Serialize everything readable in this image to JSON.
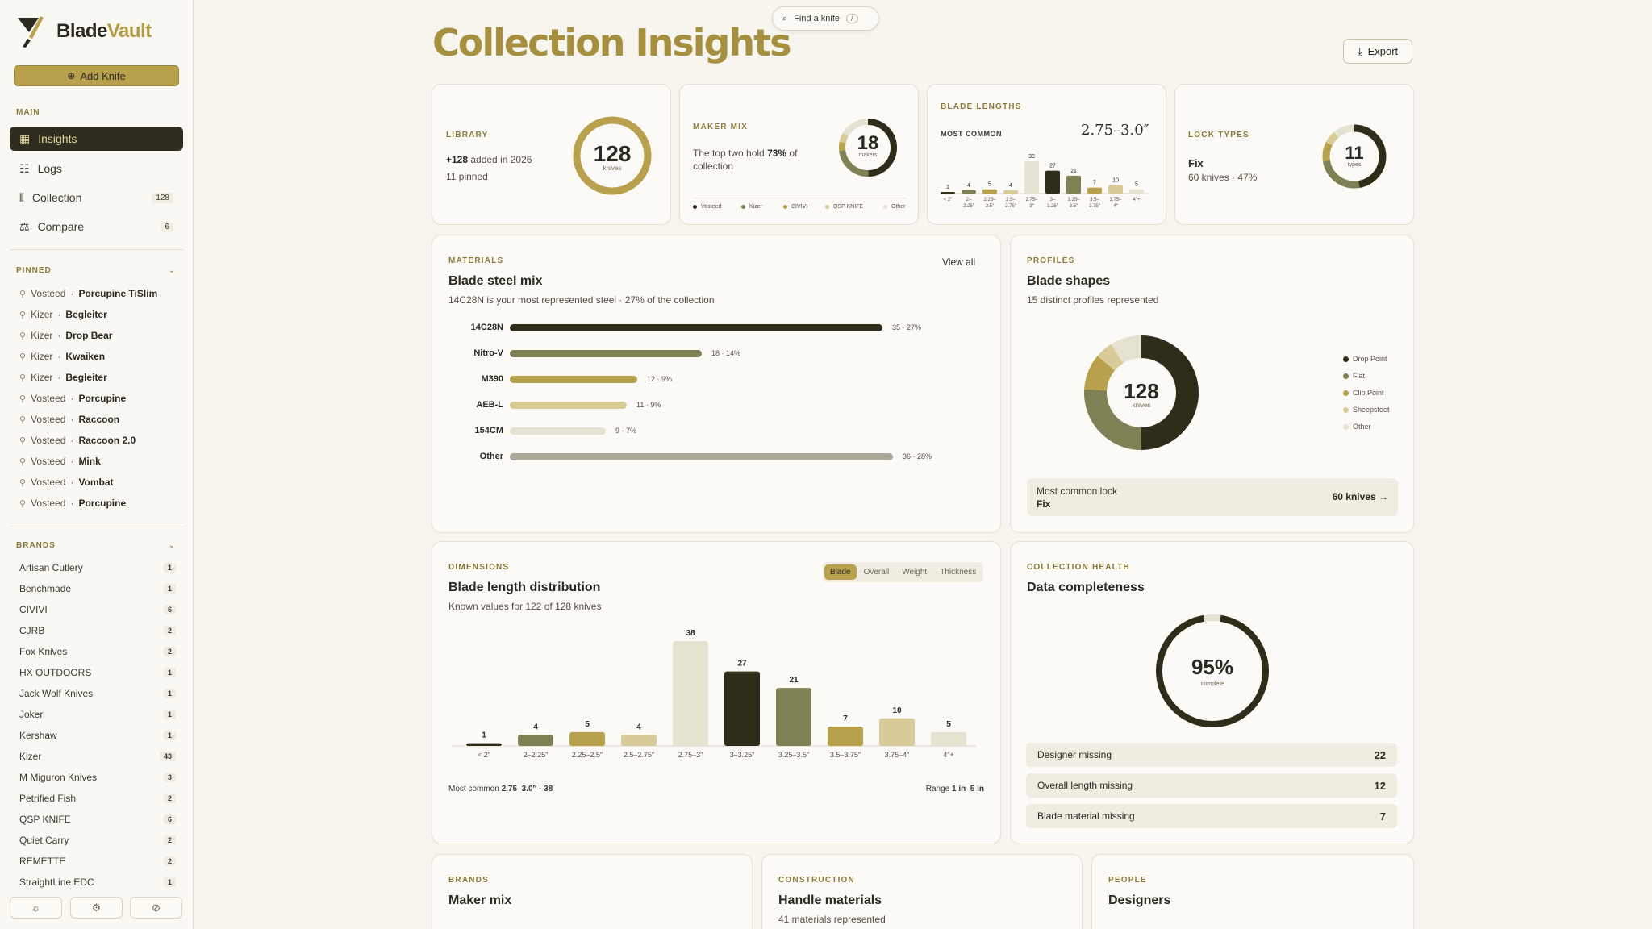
{
  "app": {
    "brand_a": "Blade",
    "brand_b": "Vault",
    "add_label": "Add Knife"
  },
  "search": {
    "label": "Find a knife",
    "shortcut": "/"
  },
  "nav": {
    "section": "MAIN",
    "items": [
      {
        "label": "Insights",
        "count": ""
      },
      {
        "label": "Logs",
        "count": ""
      },
      {
        "label": "Collection",
        "count": "128"
      },
      {
        "label": "Compare",
        "count": "6"
      }
    ]
  },
  "pinned": {
    "section": "PINNED",
    "items": [
      {
        "brand": "Vosteed",
        "model": "Porcupine TiSlim"
      },
      {
        "brand": "Kizer",
        "model": "Begleiter"
      },
      {
        "brand": "Kizer",
        "model": "Drop Bear"
      },
      {
        "brand": "Kizer",
        "model": "Kwaiken"
      },
      {
        "brand": "Kizer",
        "model": "Begleiter"
      },
      {
        "brand": "Vosteed",
        "model": "Porcupine"
      },
      {
        "brand": "Vosteed",
        "model": "Raccoon"
      },
      {
        "brand": "Vosteed",
        "model": "Raccoon 2.0"
      },
      {
        "brand": "Vosteed",
        "model": "Mink"
      },
      {
        "brand": "Vosteed",
        "model": "Vombat"
      },
      {
        "brand": "Vosteed",
        "model": "Porcupine"
      }
    ]
  },
  "brands": {
    "section": "BRANDS",
    "items": [
      {
        "name": "Artisan Cutlery",
        "count": "1"
      },
      {
        "name": "Benchmade",
        "count": "1"
      },
      {
        "name": "CIVIVI",
        "count": "6"
      },
      {
        "name": "CJRB",
        "count": "2"
      },
      {
        "name": "Fox Knives",
        "count": "2"
      },
      {
        "name": "HX OUTDOORS",
        "count": "1"
      },
      {
        "name": "Jack Wolf Knives",
        "count": "1"
      },
      {
        "name": "Joker",
        "count": "1"
      },
      {
        "name": "Kershaw",
        "count": "1"
      },
      {
        "name": "Kizer",
        "count": "43"
      },
      {
        "name": "M Miguron Knives",
        "count": "3"
      },
      {
        "name": "Petrified Fish",
        "count": "2"
      },
      {
        "name": "QSP KNIFE",
        "count": "6"
      },
      {
        "name": "Quiet Carry",
        "count": "2"
      },
      {
        "name": "REMETTE",
        "count": "2"
      },
      {
        "name": "StraightLine EDC",
        "count": "1"
      }
    ]
  },
  "page": {
    "title": "Collection Insights",
    "export": "Export"
  },
  "library": {
    "eyebrow": "LIBRARY",
    "added_num": "+128",
    "added_text": " added in 2026",
    "pinned": "11 pinned",
    "total": "128",
    "unit": "knives"
  },
  "maker_mix": {
    "eyebrow": "MAKER MIX",
    "text_a": "The top two hold ",
    "pct": "73%",
    "text_b": " of collection",
    "count": "18",
    "unit": "makers",
    "legend": [
      "Vosteed",
      "Kizer",
      "CIVIVI",
      "QSP KNIFE",
      "Other"
    ]
  },
  "blade_lengths_card": {
    "eyebrow": "BLADE LENGTHS",
    "most_common_label": "MOST COMMON",
    "most_common": "2.75–3.0″",
    "labels": [
      "< 2″",
      "2–2.25″",
      "2.25–2.5″",
      "2.5–2.75″",
      "2.75–3″",
      "3–3.25″",
      "3.25–3.5″",
      "3.5–3.75″",
      "3.75–4″",
      "4″+"
    ],
    "values": [
      1,
      4,
      5,
      4,
      38,
      27,
      21,
      7,
      10,
      5
    ]
  },
  "lock_types": {
    "eyebrow": "LOCK TYPES",
    "name": "Fix",
    "detail": "60 knives · 47%",
    "count": "11",
    "unit": "types"
  },
  "materials": {
    "eyebrow": "MATERIALS",
    "title": "Blade steel mix",
    "view_all": "View all",
    "subtitle": "14C28N is your most represented steel · 27% of the collection",
    "rows": [
      {
        "name": "14C28N",
        "value": 35,
        "label": "35 · 27%"
      },
      {
        "name": "Nitro-V",
        "value": 18,
        "label": "18 · 14%"
      },
      {
        "name": "M390",
        "value": 12,
        "label": "12 · 9%"
      },
      {
        "name": "AEB-L",
        "value": 11,
        "label": "11 · 9%"
      },
      {
        "name": "154CM",
        "value": 9,
        "label": "9 · 7%"
      },
      {
        "name": "Other",
        "value": 36,
        "label": "36 · 28%"
      }
    ]
  },
  "profiles": {
    "eyebrow": "PROFILES",
    "title": "Blade shapes",
    "subtitle": "15 distinct profiles represented",
    "total": "128",
    "unit": "knives",
    "legend": [
      "Drop Point",
      "Flat",
      "Clip Point",
      "Sheepsfoot",
      "Other"
    ],
    "lock_label": "Most common lock",
    "lock_name": "Fix",
    "lock_value": "60 knives →"
  },
  "dimensions": {
    "eyebrow": "DIMENSIONS",
    "title": "Blade length distribution",
    "subtitle": "Known values for 122 of 128 knives",
    "tabs": [
      "Blade",
      "Overall",
      "Weight",
      "Thickness"
    ],
    "footer_left_a": "Most common ",
    "footer_left_b": "2.75–3.0″ · 38",
    "footer_right_a": "Range ",
    "footer_right_b": "1 in–5 in"
  },
  "health": {
    "eyebrow": "COLLECTION HEALTH",
    "title": "Data completeness",
    "pct": "95%",
    "unit": "complete",
    "rows": [
      {
        "label": "Designer missing",
        "value": "22"
      },
      {
        "label": "Overall length missing",
        "value": "12"
      },
      {
        "label": "Blade material missing",
        "value": "7"
      }
    ]
  },
  "bottom": {
    "brands": {
      "eyebrow": "BRANDS",
      "title": "Maker mix"
    },
    "construction": {
      "eyebrow": "CONSTRUCTION",
      "title": "Handle materials",
      "subtitle": "41 materials represented"
    },
    "people": {
      "eyebrow": "PEOPLE",
      "title": "Designers"
    }
  },
  "colors": {
    "dark": "#2e2d1a",
    "olive": "#7d8153",
    "gold": "#b8a04c",
    "sand": "#d9cb98",
    "pale": "#e6e2d2",
    "grey": "#a9a89a"
  },
  "chart_data": {
    "type": "bar",
    "title": "Blade length distribution",
    "categories": [
      "< 2″",
      "2–2.25″",
      "2.25–2.5″",
      "2.5–2.75″",
      "2.75–3″",
      "3–3.25″",
      "3.25–3.5″",
      "3.5–3.75″",
      "3.75–4″",
      "4″+"
    ],
    "values": [
      1,
      4,
      5,
      4,
      38,
      27,
      21,
      7,
      10,
      5
    ],
    "xlabel": "",
    "ylabel": ""
  }
}
